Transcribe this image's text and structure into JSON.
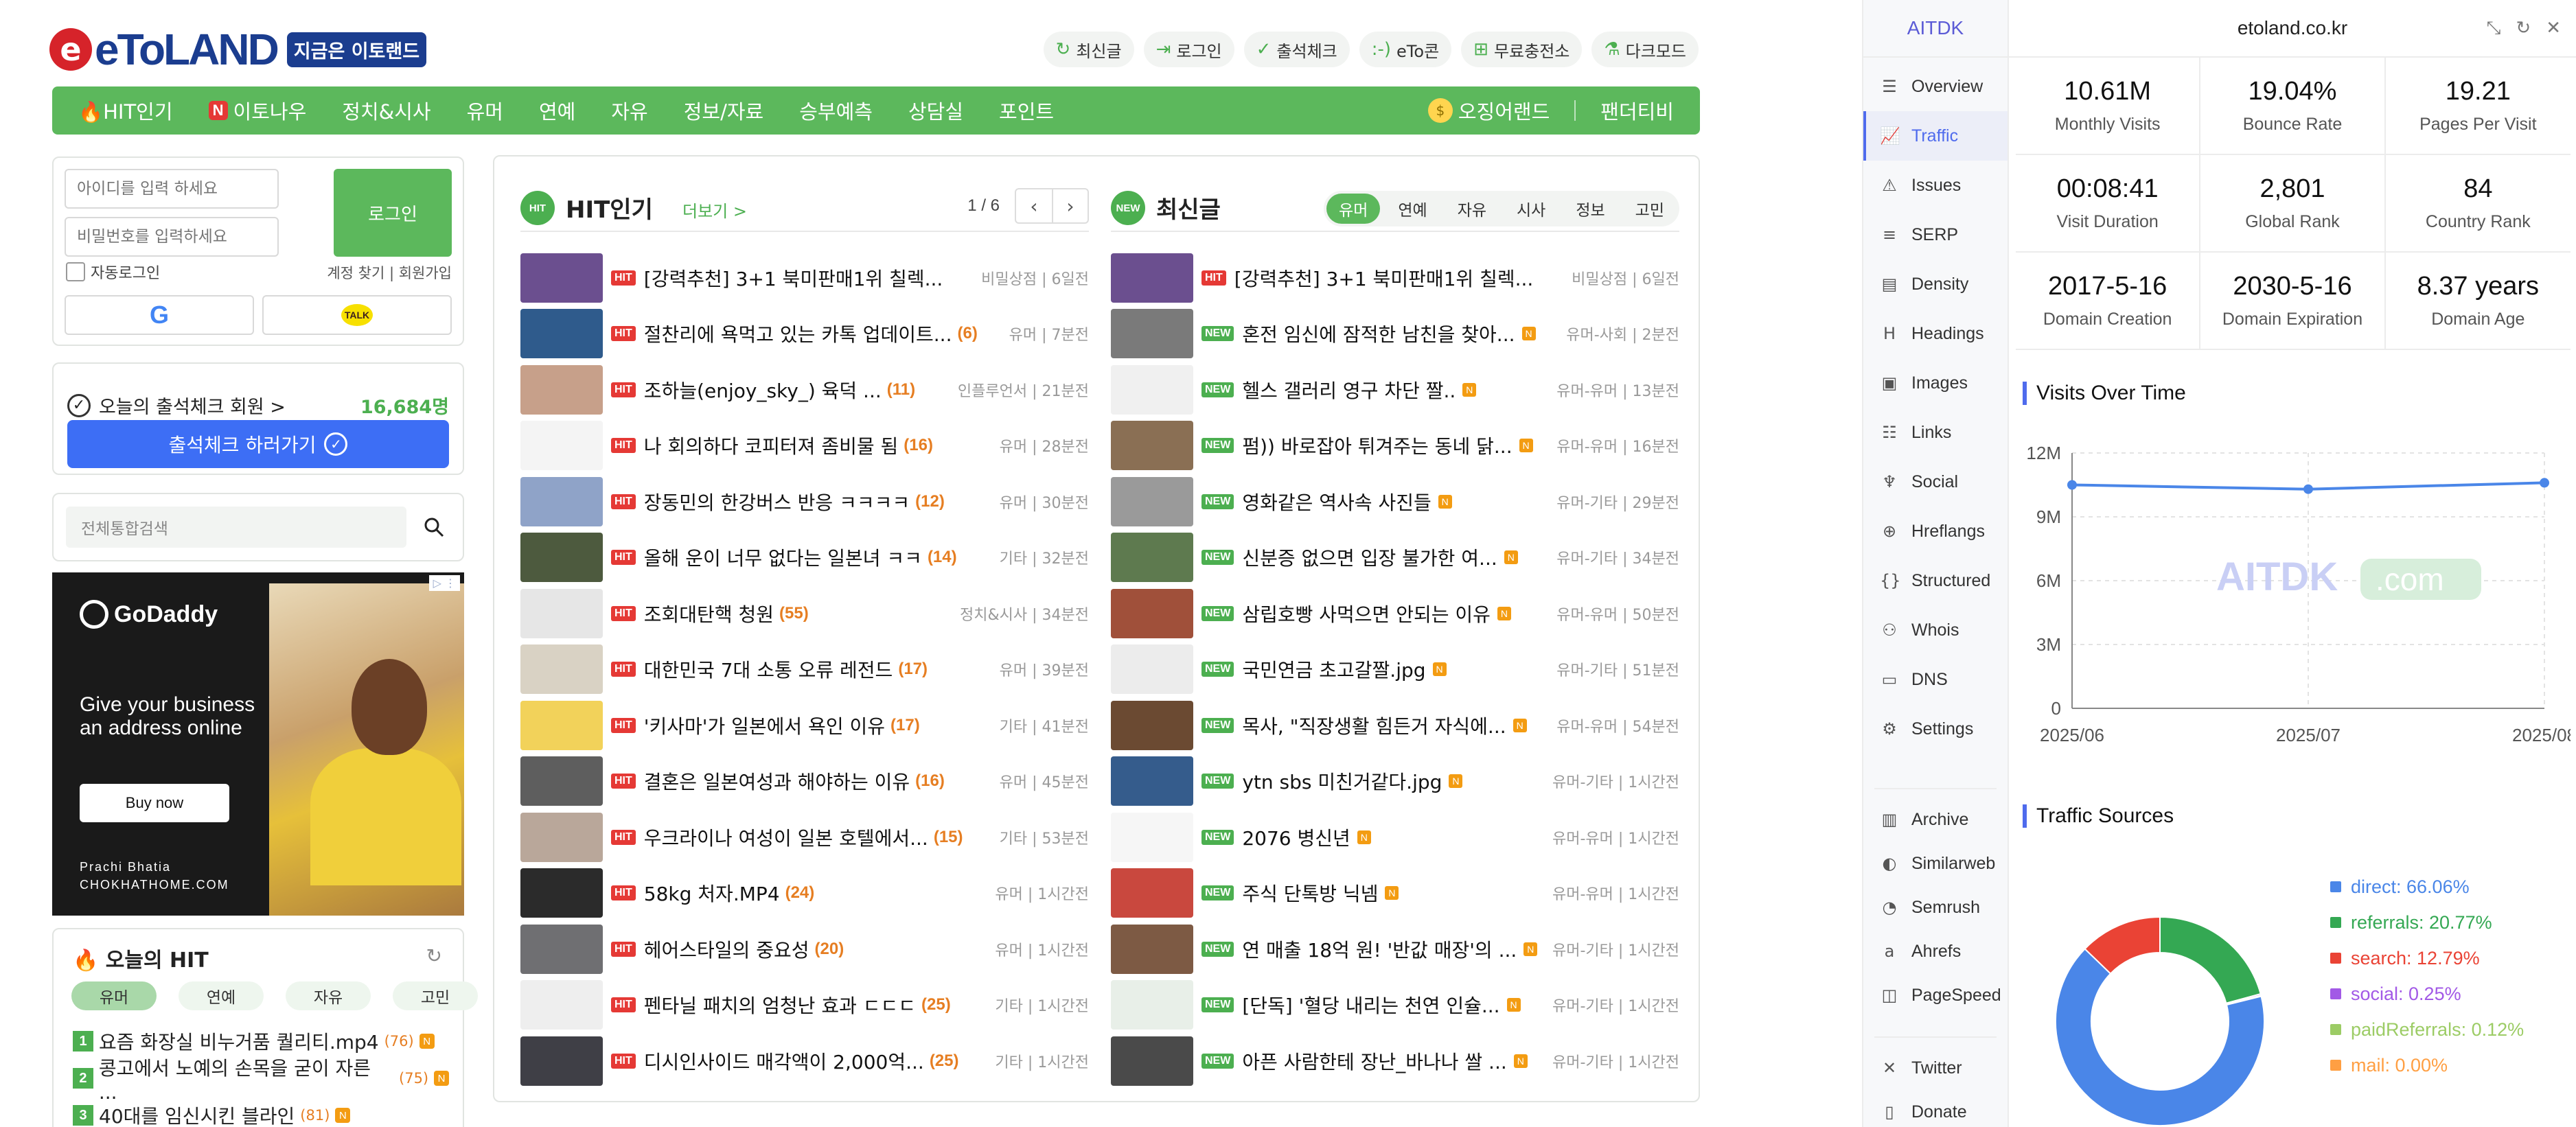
{
  "site": {
    "logo_letter": "e",
    "logo_text": "eToLAND",
    "slogan": "지금은 이토랜드",
    "toplinks": [
      {
        "icon": "refresh-icon",
        "glyph": "↻",
        "label": "최신글"
      },
      {
        "icon": "login-icon",
        "glyph": "⇥",
        "label": "로그인"
      },
      {
        "icon": "check-icon",
        "glyph": "✓",
        "label": "출석체크"
      },
      {
        "icon": "emoticon-icon",
        "glyph": ":-)",
        "label": "eTo콘"
      },
      {
        "icon": "charge-icon",
        "glyph": "⊞",
        "label": "무료충전소"
      },
      {
        "icon": "flask-icon",
        "glyph": "⚗",
        "label": "다크모드"
      }
    ],
    "nav": [
      {
        "label": "🔥HIT인기"
      },
      {
        "label": "이토나우",
        "badge": "N"
      },
      {
        "label": "정치&시사"
      },
      {
        "label": "유머"
      },
      {
        "label": "연예"
      },
      {
        "label": "자유"
      },
      {
        "label": "정보/자료"
      },
      {
        "label": "승부예측"
      },
      {
        "label": "상담실"
      },
      {
        "label": "포인트"
      }
    ],
    "nav_right": [
      "오징어랜드",
      "팬더티비"
    ],
    "login": {
      "id_placeholder": "아이디를 입력 하세요",
      "pw_placeholder": "비밀번호를 입력하세요",
      "button": "로그인",
      "auto_login": "자동로그인",
      "find": "계정 찾기 | 회원가입",
      "google": "G",
      "kakao": "TALK"
    },
    "attend": {
      "label": "오늘의 출석체크 회원 >",
      "count": "16,684명",
      "button": "출석체크 하러가기"
    },
    "search_placeholder": "전체통합검색",
    "ad": {
      "brand": "GoDaddy",
      "tagline_1": "Give your business",
      "tagline_2": "an address online",
      "button": "Buy now",
      "credit_1": "Prachi Bhatia",
      "credit_2": "CHOKHATHOME.COM"
    },
    "today_hit": {
      "title": "🔥 오늘의 HIT",
      "tabs": [
        "유머",
        "연예",
        "자유",
        "고민"
      ],
      "items": [
        {
          "num": "1",
          "title": "요즘 화장실 비누거품 퀄리티.mp4",
          "count": "(76)"
        },
        {
          "num": "2",
          "title": "콩고에서 노예의 손목을 굳이 자른 ...",
          "count": "(75)"
        },
        {
          "num": "3",
          "title": "40대를 임신시킨 블라인",
          "count": "(81)"
        }
      ]
    },
    "hit": {
      "badge": "HIT",
      "title": "HIT인기",
      "more": "더보기 >",
      "pager": "1 / 6",
      "rows": [
        {
          "title": "[강력추천] 3+1 북미판매1위 칠렉...",
          "count": "",
          "meta": "비밀상점 | 6일전",
          "thumb": "#6b4f8f"
        },
        {
          "title": "절찬리에 욕먹고 있는 카톡 업데이트...",
          "count": "(6)",
          "meta": "유머 | 7분전",
          "thumb": "#2f5b8c"
        },
        {
          "title": "조하늘(enjoy_sky_) 육덕 ...",
          "count": "(11)",
          "meta": "인플루언서 | 21분전",
          "thumb": "#c7a08a"
        },
        {
          "title": "나 회의하다 코피터져 좀비물 됨",
          "count": "(16)",
          "meta": "유머 | 28분전",
          "thumb": "#f4f4f4"
        },
        {
          "title": "장동민의 한강버스 반응 ㅋㅋㅋㅋ",
          "count": "(12)",
          "meta": "유머 | 30분전",
          "thumb": "#8fa3c8"
        },
        {
          "title": "올해 운이 너무 없다는 일본녀 ㅋㅋ",
          "count": "(14)",
          "meta": "기타 | 32분전",
          "thumb": "#4d5a3e"
        },
        {
          "title": "조회대탄핵 청원",
          "count": "(55)",
          "meta": "정치&시사 | 34분전",
          "thumb": "#e6e6e6"
        },
        {
          "title": "대한민국 7대 소통 오류 레전드",
          "count": "(17)",
          "meta": "유머 | 39분전",
          "thumb": "#d9d2c4"
        },
        {
          "title": "'키사마'가 일본에서 욕인 이유",
          "count": "(17)",
          "meta": "기타 | 41분전",
          "thumb": "#f2d25a"
        },
        {
          "title": "결혼은 일본여성과 해야하는 이유",
          "count": "(16)",
          "meta": "유머 | 45분전",
          "thumb": "#5e5e5e"
        },
        {
          "title": "우크라이나 여성이 일본 호텔에서...",
          "count": "(15)",
          "meta": "기타 | 53분전",
          "thumb": "#b9a79a"
        },
        {
          "title": "58kg 처자.MP4",
          "count": "(24)",
          "meta": "유머 | 1시간전",
          "thumb": "#2b2b2b"
        },
        {
          "title": "헤어스타일의 중요성",
          "count": "(20)",
          "meta": "유머 | 1시간전",
          "thumb": "#6f6f72"
        },
        {
          "title": "펜타닐 패치의 엄청난 효과 ㄷㄷㄷ",
          "count": "(25)",
          "meta": "기타 | 1시간전",
          "thumb": "#eeeeee"
        },
        {
          "title": "디시인사이드 매각액이 2,000억...",
          "count": "(25)",
          "meta": "기타 | 1시간전",
          "thumb": "#3f3f46"
        }
      ]
    },
    "latest": {
      "badge": "NEW",
      "title": "최신글",
      "tabs": [
        "유머",
        "연예",
        "자유",
        "시사",
        "정보",
        "고민"
      ],
      "rows": [
        {
          "title": "[강력추천] 3+1 북미판매1위 칠렉...",
          "new": false,
          "meta": "비밀상점 | 6일전",
          "thumb": "#6b4f8f"
        },
        {
          "title": "혼전 임신에 잠적한 남친을 찾아...",
          "new": true,
          "meta": "유머-사회 | 2분전",
          "thumb": "#7a7a7a"
        },
        {
          "title": "헬스 갤러리 영구 차단 짤..",
          "new": true,
          "meta": "유머-유머 | 13분전",
          "thumb": "#f0f0f0"
        },
        {
          "title": "펌)) 바로잡아 튀겨주는 동네 닭...",
          "new": true,
          "meta": "유머-유머 | 16분전",
          "thumb": "#8a6f54"
        },
        {
          "title": "영화같은 역사속 사진들",
          "new": true,
          "meta": "유머-기타 | 29분전",
          "thumb": "#9a9a9a"
        },
        {
          "title": "신분증 없으면 입장 불가한 여...",
          "new": true,
          "meta": "유머-기타 | 34분전",
          "thumb": "#5e7a4f"
        },
        {
          "title": "삼립호빵 사먹으면 안되는 이유",
          "new": true,
          "meta": "유머-유머 | 50분전",
          "thumb": "#a0503a"
        },
        {
          "title": "국민연금 초고갈짤.jpg",
          "new": true,
          "meta": "유머-기타 | 51분전",
          "thumb": "#ececec"
        },
        {
          "title": "목사, \"직장생활 힘든거 자식에...",
          "new": true,
          "meta": "유머-유머 | 54분전",
          "thumb": "#6b4a32"
        },
        {
          "title": "ytn sbs 미친거같다.jpg",
          "new": true,
          "meta": "유머-기타 | 1시간전",
          "thumb": "#355c8c"
        },
        {
          "title": "2076 병신년",
          "new": true,
          "meta": "유머-유머 | 1시간전",
          "thumb": "#f6f6f6"
        },
        {
          "title": "주식 단톡방 닉넴",
          "new": true,
          "meta": "유머-유머 | 1시간전",
          "thumb": "#c9483e"
        },
        {
          "title": "연 매출 18억 원! '반값 매장'의 ...",
          "new": true,
          "meta": "유머-기타 | 1시간전",
          "thumb": "#7d5a44"
        },
        {
          "title": "[단독] '혈당 내리는 천연 인슐...",
          "new": true,
          "meta": "유머-기타 | 1시간전",
          "thumb": "#e8efe8"
        },
        {
          "title": "아픈 사람한테 장난_바나나 쌀 ...",
          "new": true,
          "meta": "유머-기타 | 1시간전",
          "thumb": "#4a4a4a"
        }
      ]
    }
  },
  "aitdk": {
    "brand": "AITDK",
    "domain": "etoland.co.kr",
    "menu": [
      {
        "label": "Overview",
        "icon": "overview-icon",
        "glyph": "☰"
      },
      {
        "label": "Traffic",
        "icon": "traffic-icon",
        "glyph": "📈",
        "active": true
      },
      {
        "label": "Issues",
        "icon": "warning-icon",
        "glyph": "⚠"
      },
      {
        "label": "SERP",
        "icon": "serp-icon",
        "glyph": "≡"
      },
      {
        "label": "Density",
        "icon": "density-icon",
        "glyph": "▤"
      },
      {
        "label": "Headings",
        "icon": "heading-icon",
        "glyph": "H"
      },
      {
        "label": "Images",
        "icon": "image-icon",
        "glyph": "▣"
      },
      {
        "label": "Links",
        "icon": "links-icon",
        "glyph": "☷"
      },
      {
        "label": "Social",
        "icon": "social-icon",
        "glyph": "♆"
      },
      {
        "label": "Hreflangs",
        "icon": "globe-icon",
        "glyph": "⊕"
      },
      {
        "label": "Structured",
        "icon": "braces-icon",
        "glyph": "{}"
      },
      {
        "label": "Whois",
        "icon": "user-icon",
        "glyph": "⚇"
      },
      {
        "label": "DNS",
        "icon": "server-icon",
        "glyph": "▭"
      },
      {
        "label": "Settings",
        "icon": "gear-icon",
        "glyph": "⚙"
      }
    ],
    "menu_tools": [
      {
        "label": "Archive",
        "icon": "archive-icon",
        "glyph": "▥"
      },
      {
        "label": "Similarweb",
        "icon": "similarweb-icon",
        "glyph": "◐"
      },
      {
        "label": "Semrush",
        "icon": "semrush-icon",
        "glyph": "◔"
      },
      {
        "label": "Ahrefs",
        "icon": "ahrefs-icon",
        "glyph": "a"
      },
      {
        "label": "PageSpeed",
        "icon": "pagespeed-icon",
        "glyph": "◫"
      }
    ],
    "menu_bottom": [
      {
        "label": "Twitter",
        "icon": "twitter-icon",
        "glyph": "✕"
      },
      {
        "label": "Donate",
        "icon": "donate-icon",
        "glyph": "▯"
      }
    ],
    "stats": [
      {
        "value": "10.61M",
        "label": "Monthly Visits"
      },
      {
        "value": "19.04%",
        "label": "Bounce Rate"
      },
      {
        "value": "19.21",
        "label": "Pages Per Visit"
      },
      {
        "value": "00:08:41",
        "label": "Visit Duration"
      },
      {
        "value": "2,801",
        "label": "Global Rank"
      },
      {
        "value": "84",
        "label": "Country Rank"
      },
      {
        "value": "2017-5-16",
        "label": "Domain Creation"
      },
      {
        "value": "2030-5-16",
        "label": "Domain Expiration"
      },
      {
        "value": "8.37 years",
        "label": "Domain Age"
      }
    ],
    "visits_title": "Visits Over Time",
    "sources_title": "Traffic Sources",
    "watermark": "AITDK",
    "watermark_suffix": ".com"
  },
  "chart_data": [
    {
      "type": "line",
      "title": "Visits Over Time",
      "categories": [
        "2025/06",
        "2025/07",
        "2025/08"
      ],
      "series": [
        {
          "values": [
            10.5,
            10.3,
            10.6
          ]
        }
      ],
      "yticks": [
        "0",
        "3M",
        "6M",
        "9M",
        "12M"
      ],
      "ylim": [
        0,
        12
      ],
      "grid": true,
      "color": "#4a86e8"
    },
    {
      "type": "pie",
      "title": "Traffic Sources",
      "donut": true,
      "slices": [
        {
          "name": "direct",
          "value": 66.06,
          "label": "direct: 66.06%",
          "color": "#4a86e8"
        },
        {
          "name": "referrals",
          "value": 20.77,
          "label": "referrals: 20.77%",
          "color": "#34a853"
        },
        {
          "name": "search",
          "value": 12.79,
          "label": "search: 12.79%",
          "color": "#ea4335"
        },
        {
          "name": "social",
          "value": 0.25,
          "label": "social: 0.25%",
          "color": "#a259e6"
        },
        {
          "name": "paidReferrals",
          "value": 0.12,
          "label": "paidReferrals: 0.12%",
          "color": "#9ccc65"
        },
        {
          "name": "mail",
          "value": 0.0,
          "label": "mail: 0.00%",
          "color": "#ff9f43"
        }
      ],
      "legend": "right"
    }
  ]
}
